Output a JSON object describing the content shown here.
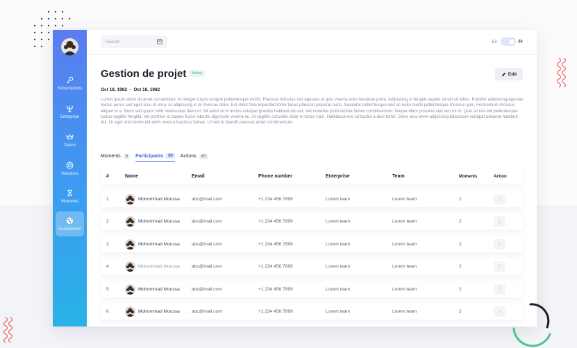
{
  "search": {
    "placeholder": "Search"
  },
  "language": {
    "en_label": "En",
    "fr_label": "Fr",
    "selected": "Fr"
  },
  "sidebar": {
    "items": [
      {
        "label": "Subscriptions",
        "icon": "key-icon"
      },
      {
        "label": "Enterprise",
        "icon": "trident-icon"
      },
      {
        "label": "Teams",
        "icon": "crown-icon"
      },
      {
        "label": "Solutions",
        "icon": "target-icon"
      },
      {
        "label": "Moments",
        "icon": "hourglass-icon"
      },
      {
        "label": "Destinations",
        "icon": "globe-icon",
        "active": true
      }
    ]
  },
  "project": {
    "title": "Gestion de projet",
    "status": "Active",
    "edit_label": "Edit",
    "dates": "Oct 18, 1982  -  Oct 18, 1982",
    "description": "Lorem ipsum dolor sit amet consectetur. In integer turpis congue pellentesque morbi. Placerat ridiculus nisl egestas ut quis viverra enim faucibus porta. Adipiscing ut feugiat sapien sit vel sit tellus. Porttitor adipiscing egestas metus purus sed eget arcu id urna. At adipiscing in at rhoncus dolor. Est dolor felis imperdiet tortor lacus placerat placerat nunc. Nascetur pellentesque sed ac nulla morbi pellentesque rhoncus quis. Fermentum rhoncus aliquet in a. Nunc sed quam nibh malesuada diam ut. Sit amet sit in lectus volutpat gravida habitant dui est. Vel molestie justo lacinia fames condimentum. Neque diam posuere sed nec mi id. Quis sit nisi elit pellentesque luctus sagittis fringilla. Vel porttitor id sapien fusce lobortis dignissim viverra eu. At sagittis convallis dolor in turpis nam. Habitasse nisi sit facilisi a duis tortor. Dolor arcu enim adipiscing bibendum volutpat placerat habitant dui. Ut eget duis lorem elit enim viverra faucibus fames. Ut sed in blandit placerat amet condimentum."
  },
  "tabs": [
    {
      "label": "Moments",
      "count": "8"
    },
    {
      "label": "Participants",
      "count": "80",
      "active": true
    },
    {
      "label": "Actions",
      "count": "80"
    }
  ],
  "table": {
    "headers": {
      "num": "#",
      "name": "Name",
      "email": "Email",
      "phone": "Phone number",
      "enterprise": "Enterprise",
      "team": "Team",
      "moments": "Moments",
      "action": "Action"
    },
    "rows": [
      {
        "num": "1",
        "name": "Mohommad Moussa",
        "email": "abc@mail.com",
        "phone": "+1 234 456 7899",
        "enterprise": "Lorem team",
        "team": "Lorem team",
        "moments": "2",
        "action": "⋮"
      },
      {
        "num": "2",
        "name": "Mohommad Moussa",
        "email": "abc@mail.com",
        "phone": "+1 234 456 7899",
        "enterprise": "Lorem team",
        "team": "Lorem team",
        "moments": "2",
        "action": "⋮"
      },
      {
        "num": "3",
        "name": "Mohommad Moussa",
        "email": "abc@mail.com",
        "phone": "+1 234 456 7899",
        "enterprise": "Lorem team",
        "team": "Lorem team",
        "moments": "2",
        "action": "⋮"
      },
      {
        "num": "4",
        "name": "Mohommad Moussa",
        "email": "abc@mail.com",
        "phone": "+1 234 456 7899",
        "enterprise": "Lorem team",
        "team": "Lorem team",
        "moments": "2",
        "action": "⋮"
      },
      {
        "num": "5",
        "name": "Mohommad Moussa",
        "email": "abc@mail.com",
        "phone": "+1 234 456 7899",
        "enterprise": "Lorem team",
        "team": "Lorem team",
        "moments": "2",
        "action": "⋮"
      },
      {
        "num": "6",
        "name": "Mohommad Moussa",
        "email": "abc@mail.com",
        "phone": "+1 234 456 7899",
        "enterprise": "Lorem team",
        "team": "Lorem team",
        "moments": "2",
        "action": "⋮"
      }
    ]
  },
  "colors": {
    "accent": "#3b5fe0",
    "sidebar_top": "#5a7cf0",
    "sidebar_bottom": "#29b2e6",
    "active_badge": "#4bb071",
    "decor_red": "#f05b5b",
    "decor_green": "#4cc38a"
  }
}
